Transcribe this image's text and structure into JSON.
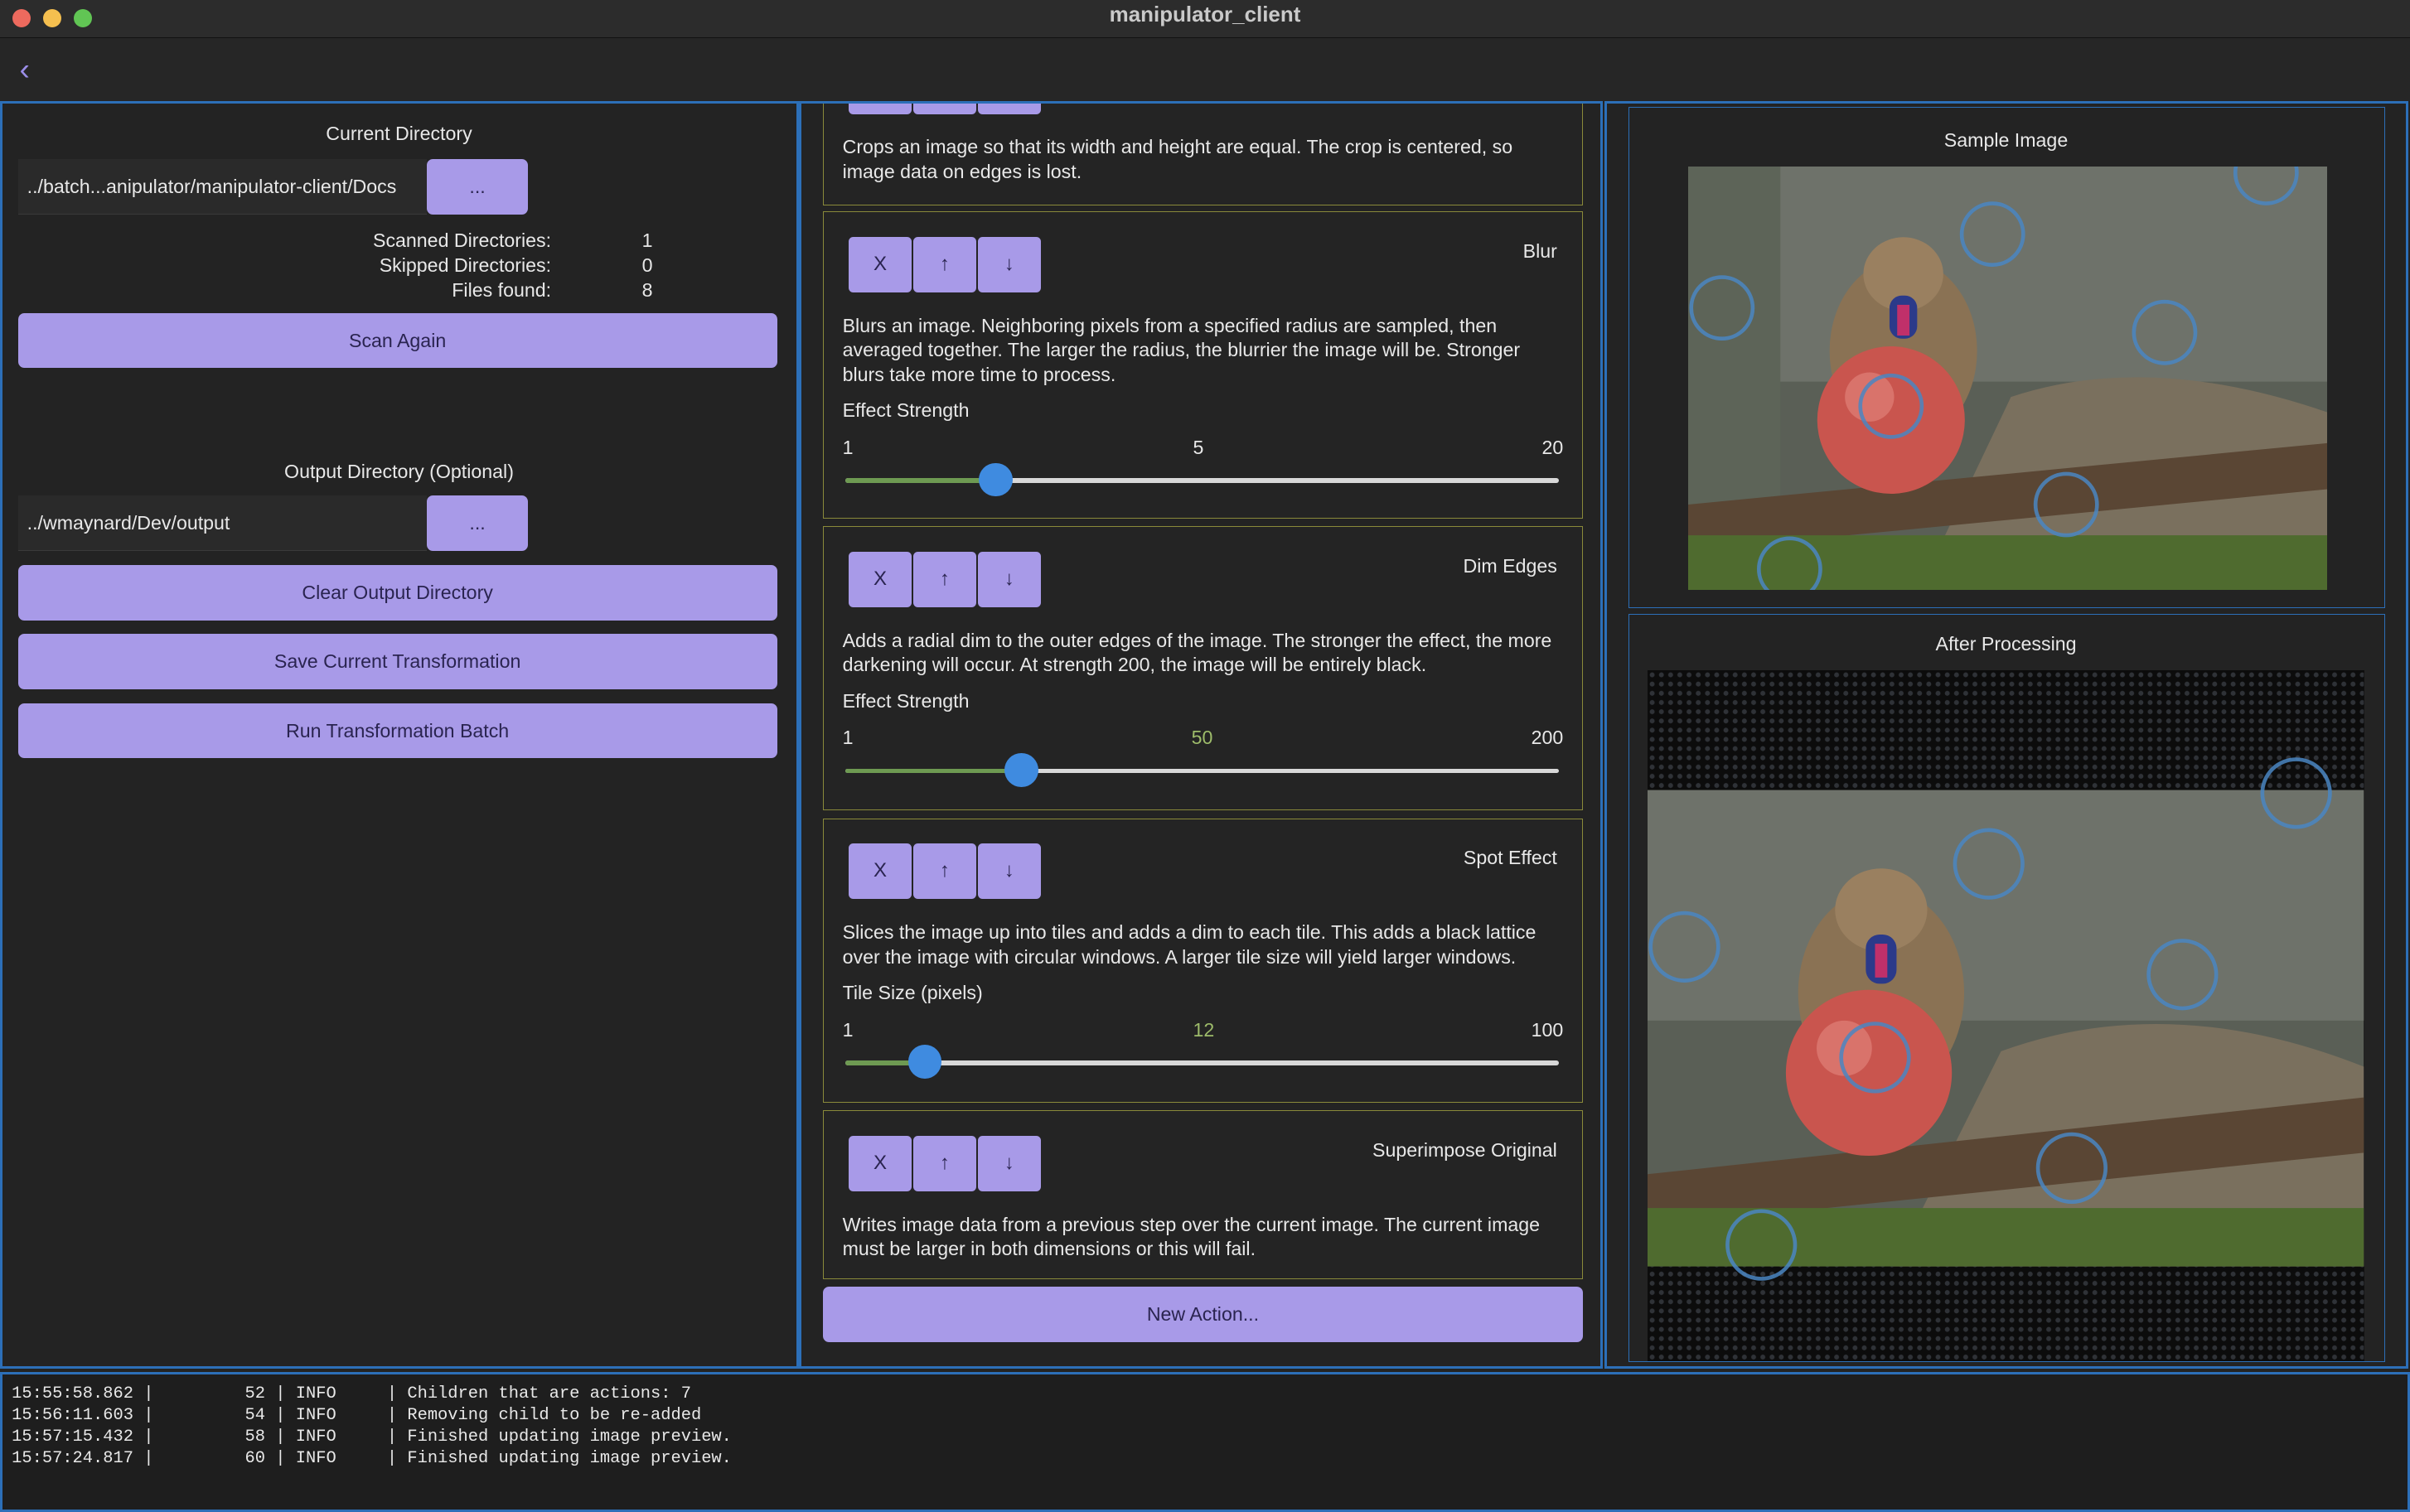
{
  "window": {
    "title": "manipulator_client"
  },
  "left": {
    "current_dir_label": "Current Directory",
    "current_dir_value": "../batch...anipulator/manipulator-client/Docs",
    "browse_label": "...",
    "stats": [
      {
        "label": "Scanned Directories:",
        "value": "1"
      },
      {
        "label": "Skipped Directories:",
        "value": "0"
      },
      {
        "label": "Files found:",
        "value": "8"
      }
    ],
    "scan_again": "Scan Again",
    "output_dir_label": "Output Directory (Optional)",
    "output_dir_value": "../wmaynard/Dev/output",
    "output_browse_label": "...",
    "clear_output": "Clear Output Directory",
    "save_transformation": "Save Current Transformation",
    "run_batch": "Run Transformation Batch"
  },
  "actions": {
    "controls": {
      "remove": "X",
      "up": "↑",
      "down": "↓"
    },
    "crop_desc": "Crops an image so that its width and height are equal.  The crop is centered, so image data on edges is lost.",
    "items": [
      {
        "title": "Blur",
        "desc": "Blurs an image.  Neighboring pixels from a specified radius are sampled, then averaged together.  The larger the radius, the blurrier the image will be.  Stronger blurs take more time to process.",
        "slider_label": "Effect Strength",
        "min": "1",
        "value": "5",
        "max": "20",
        "fraction": 0.2105
      },
      {
        "title": "Dim Edges",
        "desc": "Adds a radial dim to the outer edges of the image.  The stronger the effect, the more darkening will occur.  At strength 200, the image will be entirely black.",
        "slider_label": "Effect Strength",
        "min": "1",
        "value": "50",
        "max": "200",
        "fraction": 0.2462
      },
      {
        "title": "Spot Effect",
        "desc": "Slices the image up into tiles and adds a dim to each tile.  This adds a black lattice over the image with circular windows.  A larger tile size will yield larger windows.",
        "slider_label": "Tile Size (pixels)",
        "min": "1",
        "value": "12",
        "max": "100",
        "fraction": 0.1111
      },
      {
        "title": "Superimpose Original",
        "desc": "Writes image data from a previous step over the current image.  The current image must be larger in both dimensions or this will fail."
      }
    ],
    "new_action": "New Action..."
  },
  "preview": {
    "sample_title": "Sample Image",
    "after_title": "After Processing"
  },
  "log": {
    "lines": [
      "15:55:58.862 |         52 | INFO     | Children that are actions: 7",
      "15:56:11.603 |         54 | INFO     | Removing child to be re-added",
      "15:57:15.432 |         58 | INFO     | Finished updating image preview.",
      "15:57:24.817 |         60 | INFO     | Finished updating image preview."
    ]
  }
}
